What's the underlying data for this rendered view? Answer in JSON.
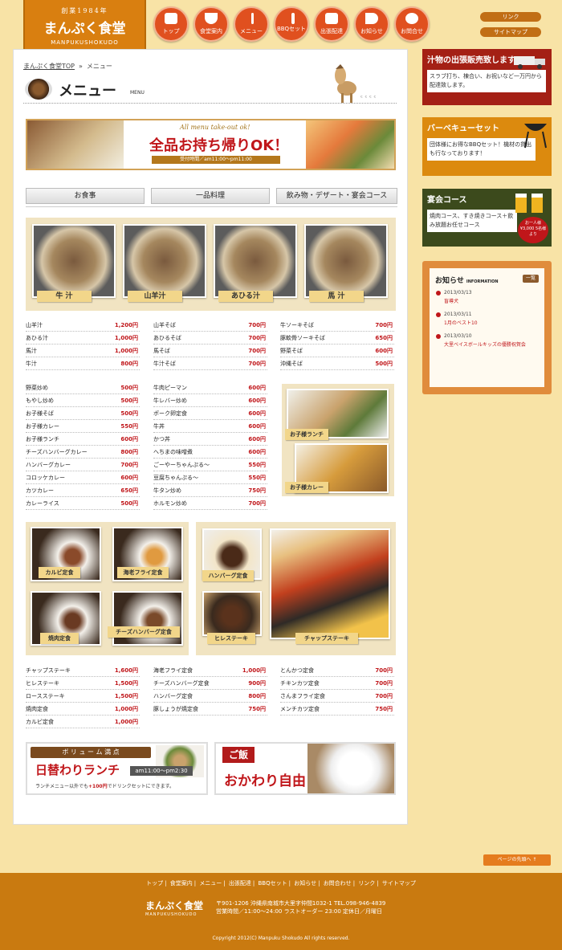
{
  "header": {
    "logo_est": "創業1984年",
    "logo_name": "まんぷく食堂",
    "logo_roman": "MANPUKUSHOKUDO",
    "nav": [
      {
        "label": "トップ",
        "icon": "shop-sign-icon"
      },
      {
        "label": "食堂案内",
        "icon": "rice-bowl-icon"
      },
      {
        "label": "メニュー",
        "icon": "chopsticks-icon"
      },
      {
        "label": "BBQセット",
        "icon": "skewer-icon"
      },
      {
        "label": "出張配達",
        "icon": "truck-icon"
      },
      {
        "label": "お知らせ",
        "icon": "megaphone-icon"
      },
      {
        "label": "お問合せ",
        "icon": "telephone-icon"
      }
    ],
    "util": [
      "リンク",
      "サイトマップ"
    ]
  },
  "breadcrumb": {
    "home": "まんぷく食堂TOP",
    "sep": "»",
    "current": "メニュー"
  },
  "page_title": {
    "title": "メニュー",
    "sub": "MENU",
    "zz": "ᶜ ᶜ ᶜ ᶜ"
  },
  "banner": {
    "en": "All menu take-out ok!",
    "main": "全品お持ち帰りOK！",
    "hours": "受付時間／am11:00～pm11:00"
  },
  "tabs": [
    "お食事",
    "一品料理",
    "飲み物・デザート・宴会コース"
  ],
  "soups": [
    "牛 汁",
    "山羊汁",
    "あひる汁",
    "馬 汁"
  ],
  "menu1": [
    [
      {
        "n": "山羊汁",
        "p": "1,200円"
      },
      {
        "n": "あひる汁",
        "p": "1,000円"
      },
      {
        "n": "馬汁",
        "p": "1,000円"
      },
      {
        "n": "牛汁",
        "p": "800円"
      }
    ],
    [
      {
        "n": "山羊そば",
        "p": "700円"
      },
      {
        "n": "あひるそば",
        "p": "700円"
      },
      {
        "n": "馬そば",
        "p": "700円"
      },
      {
        "n": "牛汁そば",
        "p": "700円"
      }
    ],
    [
      {
        "n": "牛ソーキそば",
        "p": "700円"
      },
      {
        "n": "豚軟骨ソーキそば",
        "p": "650円"
      },
      {
        "n": "野菜そば",
        "p": "600円"
      },
      {
        "n": "沖縄そば",
        "p": "500円"
      }
    ]
  ],
  "menu2": [
    [
      {
        "n": "野菜炒め",
        "p": "500円"
      },
      {
        "n": "もやし炒め",
        "p": "500円"
      },
      {
        "n": "お子様そば",
        "p": "500円"
      },
      {
        "n": "お子様カレー",
        "p": "550円"
      },
      {
        "n": "お子様ランチ",
        "p": "600円"
      },
      {
        "n": "チーズハンバーグカレー",
        "p": "800円"
      },
      {
        "n": "ハンバーグカレー",
        "p": "700円"
      },
      {
        "n": "コロッケカレー",
        "p": "600円"
      },
      {
        "n": "カツカレー",
        "p": "650円"
      },
      {
        "n": "カレーライス",
        "p": "500円"
      }
    ],
    [
      {
        "n": "牛肉ピーマン",
        "p": "600円"
      },
      {
        "n": "牛レバー炒め",
        "p": "600円"
      },
      {
        "n": "ポーク卵定食",
        "p": "600円"
      },
      {
        "n": "牛丼",
        "p": "600円"
      },
      {
        "n": "かつ丼",
        "p": "600円"
      },
      {
        "n": "へちまの味噌煮",
        "p": "600円"
      },
      {
        "n": "ごーやーちゃんぷる～",
        "p": "550円"
      },
      {
        "n": "豆腐ちゃんぷる～",
        "p": "550円"
      },
      {
        "n": "牛タン炒め",
        "p": "750円"
      },
      {
        "n": "ホルモン炒め",
        "p": "700円"
      }
    ]
  ],
  "kids": [
    "お子様ランチ",
    "お子様カレー"
  ],
  "sets_left": [
    "カルビ定食",
    "海老フライ定食",
    "焼肉定食",
    "チーズハンバーグ定食"
  ],
  "sets_right": [
    "ハンバーグ定食",
    "ヒレステーキ",
    "チャップステーキ"
  ],
  "menu3": [
    [
      {
        "n": "チャップステーキ",
        "p": "1,600円"
      },
      {
        "n": "ヒレステーキ",
        "p": "1,500円"
      },
      {
        "n": "ロースステーキ",
        "p": "1,500円"
      },
      {
        "n": "焼肉定食",
        "p": "1,000円"
      },
      {
        "n": "カルビ定食",
        "p": "1,000円"
      }
    ],
    [
      {
        "n": "海老フライ定食",
        "p": "1,000円"
      },
      {
        "n": "チーズハンバーグ定食",
        "p": "900円"
      },
      {
        "n": "ハンバーグ定食",
        "p": "800円"
      },
      {
        "n": "豚しょうが焼定食",
        "p": "750円"
      }
    ],
    [
      {
        "n": "とんかつ定食",
        "p": "700円"
      },
      {
        "n": "チキンカツ定食",
        "p": "700円"
      },
      {
        "n": "さんまフライ定食",
        "p": "700円"
      },
      {
        "n": "メンチカツ定食",
        "p": "750円"
      }
    ]
  ],
  "promo1": {
    "tag": "ボ リ ュ ー ム 満 点",
    "title": "日替わりランチ",
    "time": "am11:00～pm2:30",
    "note_a": "ランチメニュー以外でも",
    "note_b": "+100円",
    "note_c": "でドリンクセットにできます。"
  },
  "promo2": {
    "tag": "ご飯",
    "title": "おかわり自由"
  },
  "sidebar": {
    "b1": {
      "title": "汁物の出張販売致します",
      "text": "スラブ打ち、棟合い、お祝いなど一万円から配達致します。"
    },
    "b2": {
      "title": "バーベキューセット",
      "text": "団体様にお得なBBQセット！機材の貸出も行なっております！"
    },
    "b3": {
      "title": "宴会コース",
      "text": "焼肉コース、すき焼きコース＋飲み放題お任せコース",
      "badge": "お一人様¥3,000 5名様より"
    },
    "news_title": "お知らせ",
    "news_sub": "INFORMATION",
    "news_more": "一覧",
    "news": [
      {
        "date": "2013/03/13",
        "title": "盲導犬"
      },
      {
        "date": "2013/03/11",
        "title": "1月のベスト10"
      },
      {
        "date": "2013/03/10",
        "title": "大里ベイスボールキッズの優勝祝賀会"
      }
    ]
  },
  "pagetop": "ページの先頭へ ↑",
  "footer": {
    "nav": [
      "トップ",
      "食堂案内",
      "メニュー",
      "出張配達",
      "BBQセット",
      "お知らせ",
      "お問合わせ",
      "リンク",
      "サイトマップ"
    ],
    "logo": "まんぷく食堂",
    "logo_roman": "MANPUKUSHOKUDO",
    "addr1": "〒901-1206 沖縄県南城市大里字仲間1032-1 TEL.098-946-4839",
    "addr2": "営業時間／11:00～24:00 ラストオーダー 23:00 定休日／月曜日",
    "copy": "Copyright 2012(C) Manpuku Shokudo All rights reserved."
  }
}
